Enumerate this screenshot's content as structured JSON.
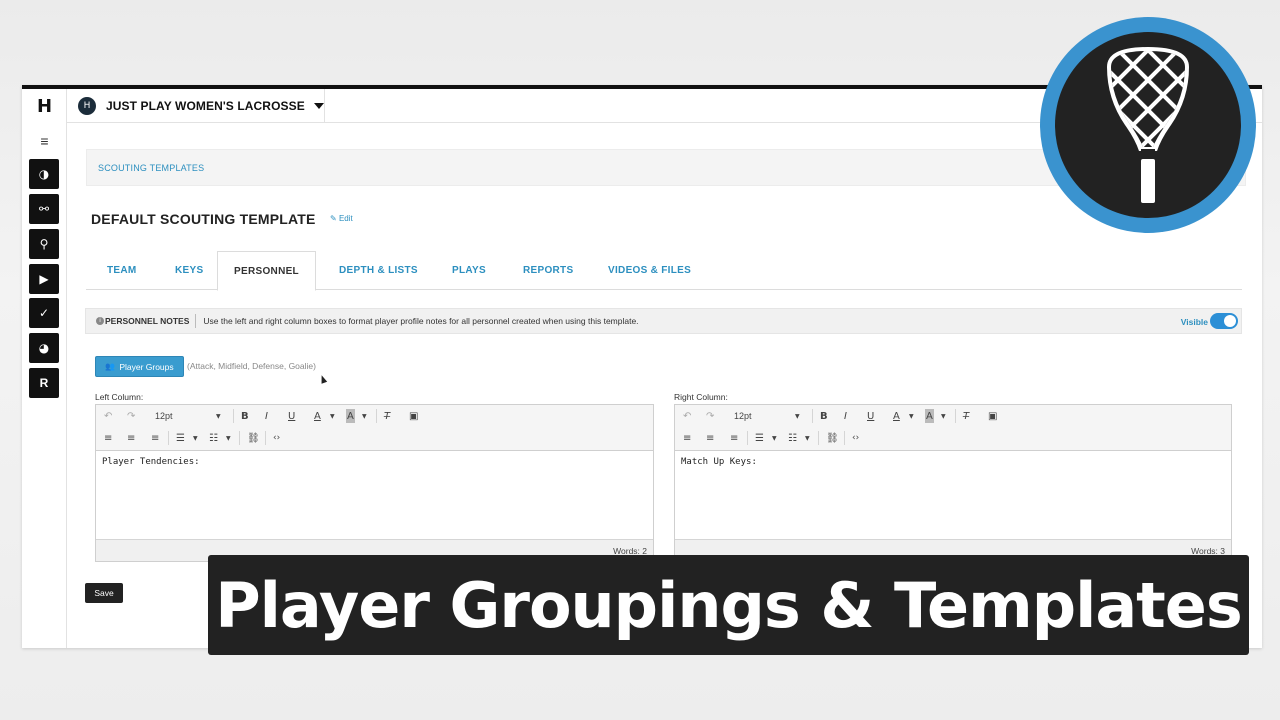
{
  "app": {
    "team_name": "JUST PLAY WOMEN'S LACROSSE",
    "logo_glyph": "H",
    "team_logo_glyph": "H"
  },
  "rail": {
    "menu_glyph": "≡",
    "buttons": [
      {
        "icon": "speedometer-icon",
        "glyph": "◑"
      },
      {
        "icon": "network-icon",
        "glyph": "⚯"
      },
      {
        "icon": "lacrosse-stick-icon",
        "glyph": "⚲"
      },
      {
        "icon": "video-icon",
        "glyph": "▶"
      },
      {
        "icon": "check-icon",
        "glyph": "✓"
      },
      {
        "icon": "pie-chart-icon",
        "glyph": "◕"
      },
      {
        "icon": "reports-icon",
        "glyph": "R"
      }
    ]
  },
  "breadcrumb": "SCOUTING TEMPLATES",
  "page": {
    "title": "DEFAULT SCOUTING TEMPLATE",
    "edit_label": "Edit"
  },
  "tabs": [
    {
      "label": "TEAM",
      "active": false
    },
    {
      "label": "KEYS",
      "active": false
    },
    {
      "label": "PERSONNEL",
      "active": true
    },
    {
      "label": "DEPTH & LISTS",
      "active": false
    },
    {
      "label": "PLAYS",
      "active": false
    },
    {
      "label": "REPORTS",
      "active": false
    },
    {
      "label": "VIDEOS & FILES",
      "active": false
    }
  ],
  "notes": {
    "label": "PERSONNEL NOTES",
    "description": "Use the left and right column boxes to format player profile notes for all personnel created when using this template.",
    "visible_label": "Visible",
    "visible_on": true
  },
  "player_groups": {
    "button_label": "Player Groups",
    "hint": "(Attack, Midfield, Defense, Goalie)"
  },
  "editors": {
    "left": {
      "label": "Left Column:",
      "font_size": "12pt",
      "content": "Player Tendencies:",
      "word_count": "Words: 2"
    },
    "right": {
      "label": "Right Column:",
      "font_size": "12pt",
      "content": "Match Up Keys:",
      "word_count": "Words: 3"
    }
  },
  "save_label": "Save",
  "banner_text": "Player Groupings & Templates",
  "colors": {
    "accent": "#2c8fbf",
    "badge_ring": "#3a93cf",
    "dark": "#222222"
  }
}
